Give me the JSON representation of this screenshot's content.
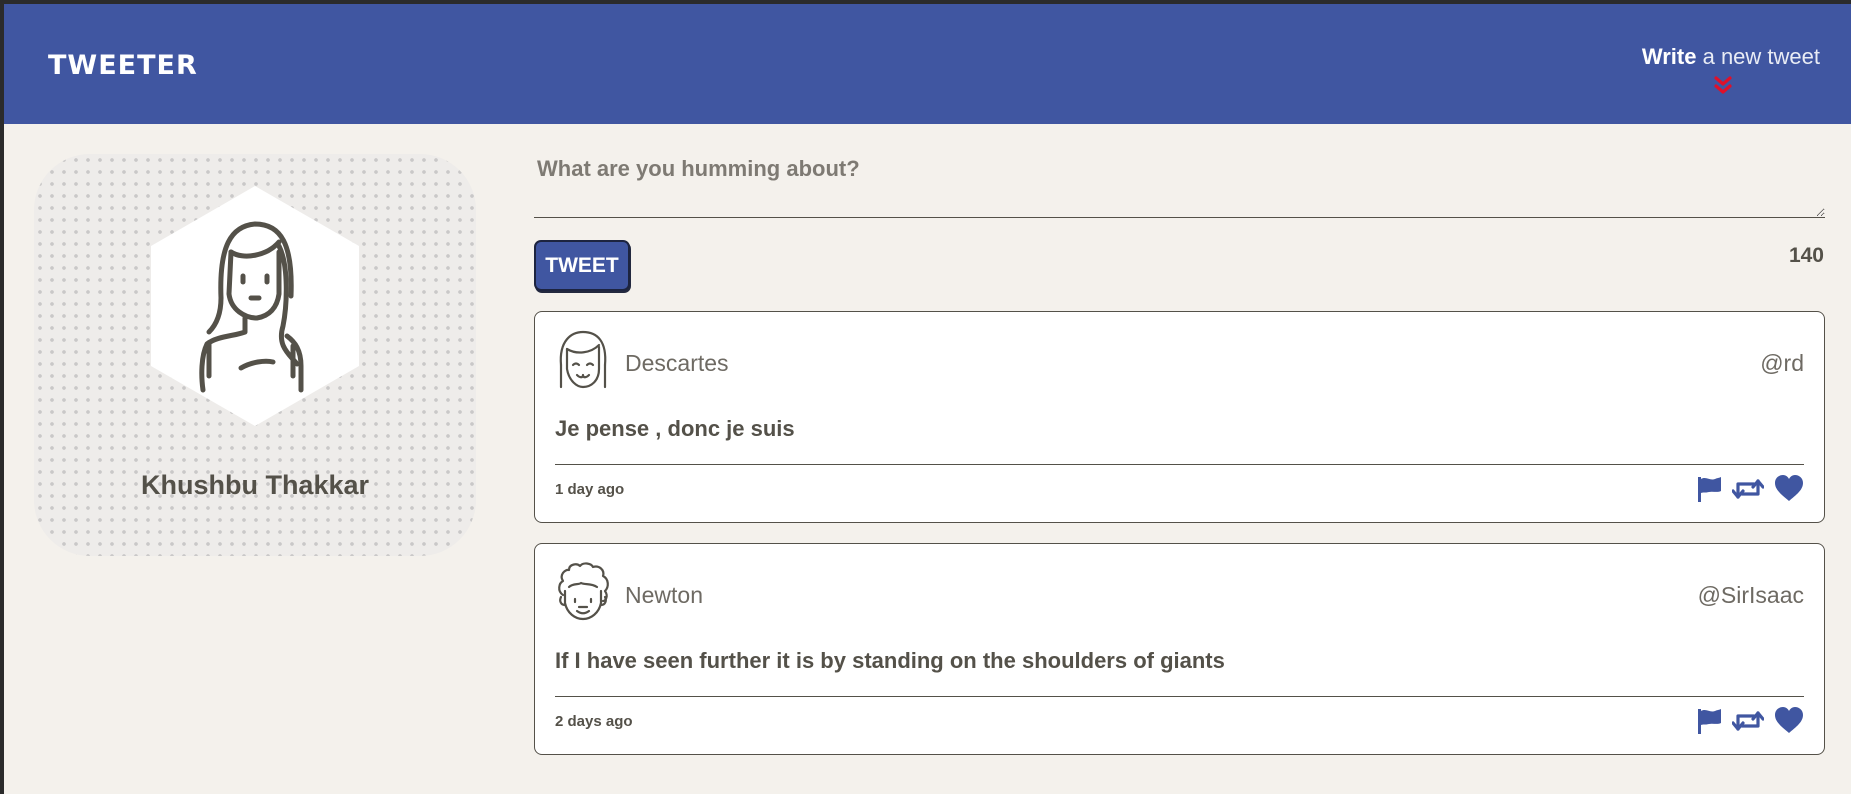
{
  "nav": {
    "brand": "TWEETER",
    "compose_strong": "Write",
    "compose_rest": " a new tweet",
    "arrow_icon": "double-chevron-down-icon"
  },
  "colors": {
    "nav_bg": "#4056a1",
    "page_bg": "#f4f1ec",
    "text": "#545149",
    "accent_arrow": "#e0102a",
    "icon_color": "#4056a1"
  },
  "profile": {
    "name": "Khushbu Thakkar",
    "avatar_icon": "woman-avatar-icon"
  },
  "composer": {
    "placeholder": "What are you humming about?",
    "value": "",
    "button_label": "TWEET",
    "counter": "140"
  },
  "tweets": [
    {
      "author": "Descartes",
      "handle": "@rd",
      "content": "Je pense , donc je suis",
      "time": "1 day ago",
      "avatar_icon": "girl-avatar-icon"
    },
    {
      "author": "Newton",
      "handle": "@SirIsaac",
      "content": "If I have seen further it is by standing on the shoulders of giants",
      "time": "2 days ago",
      "avatar_icon": "curly-hair-avatar-icon"
    }
  ],
  "tweet_actions": [
    "flag-icon",
    "retweet-icon",
    "heart-icon"
  ]
}
